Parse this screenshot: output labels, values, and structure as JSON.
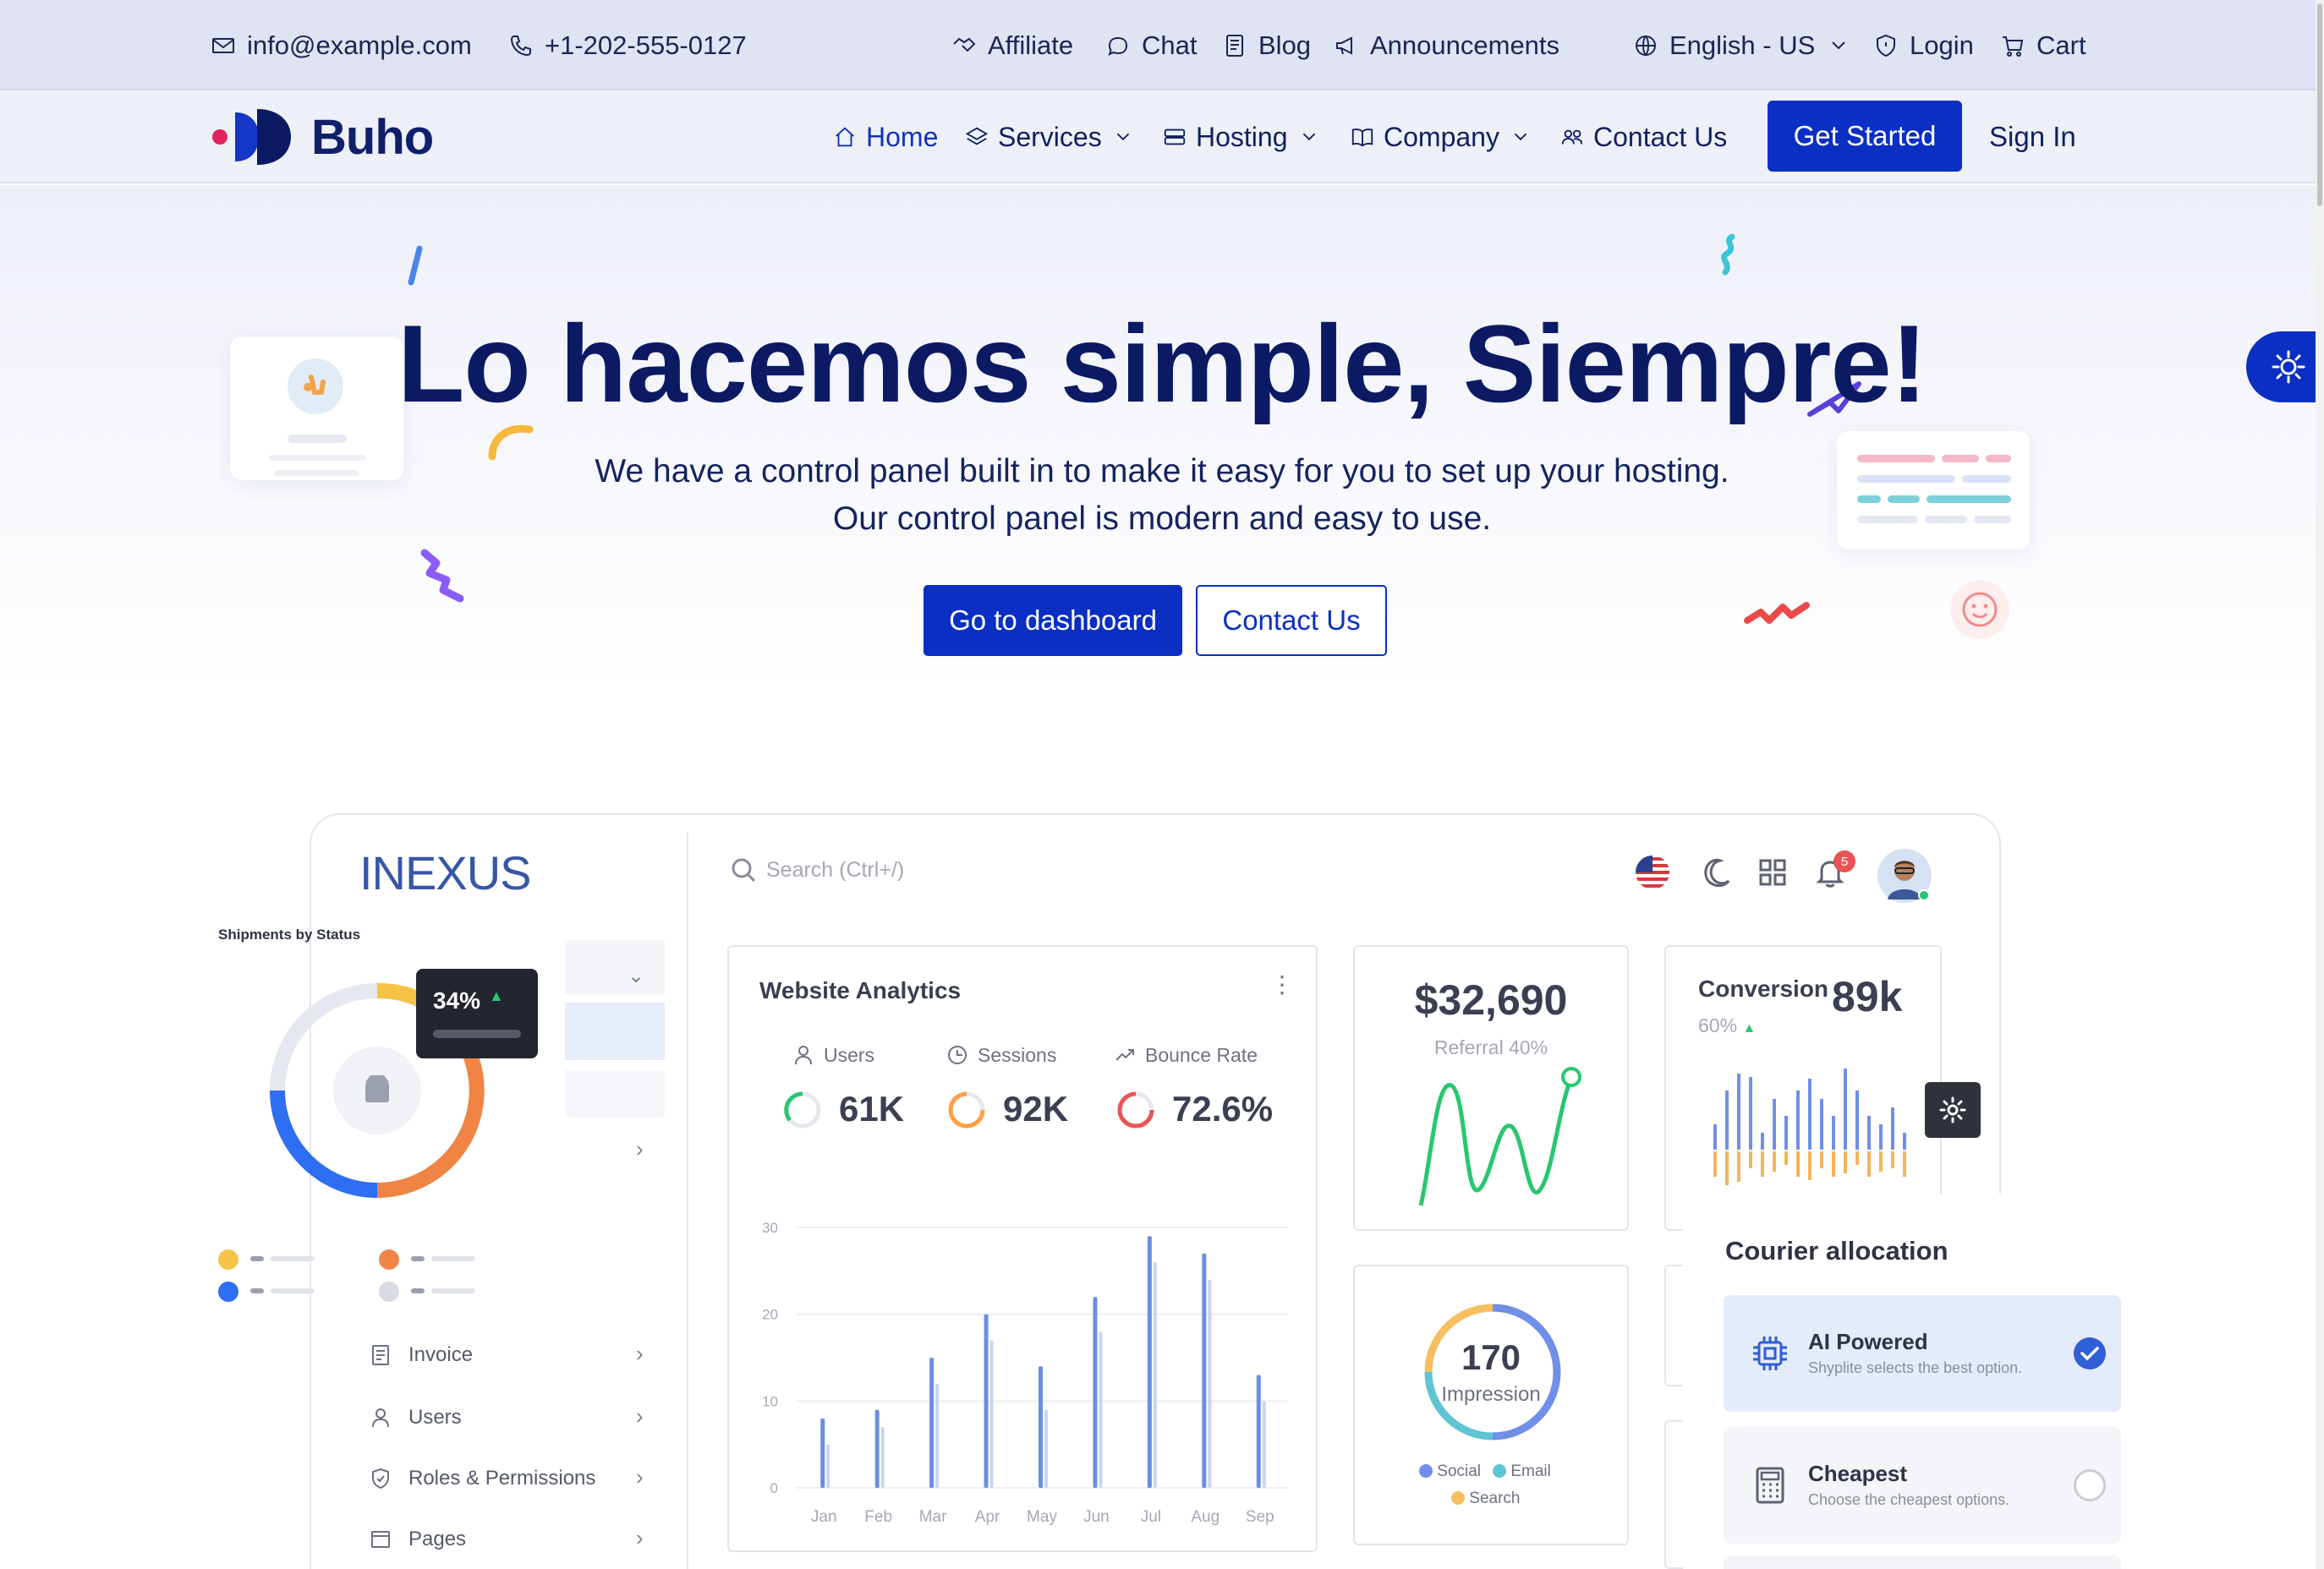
{
  "topbar": {
    "email": "info@example.com",
    "phone": "+1-202-555-0127",
    "affiliate": "Affiliate",
    "chat": "Chat",
    "blog": "Blog",
    "announcements": "Announcements",
    "language": "English - US",
    "login": "Login",
    "cart": "Cart"
  },
  "nav": {
    "brand": "Buho",
    "home": "Home",
    "services": "Services",
    "hosting": "Hosting",
    "company": "Company",
    "contact": "Contact Us",
    "get_started": "Get Started",
    "sign_in": "Sign In"
  },
  "hero": {
    "title": "Lo hacemos simple, Siempre!",
    "subtitle_line1": "We have a control panel built in to make it easy for you to set up your hosting.",
    "subtitle_line2": "Our control panel is modern and easy to use.",
    "btn_dashboard": "Go to dashboard",
    "btn_contact": "Contact Us"
  },
  "dashboard": {
    "brand": "INEXUS",
    "search_placeholder": "Search (Ctrl+/)",
    "notification_count": "5",
    "shipments_title": "Shipments by Status",
    "shipments_percent": "34%",
    "sidebar": [
      "Invoice",
      "Users",
      "Roles & Permissions",
      "Pages"
    ],
    "analytics": {
      "title": "Website Analytics",
      "users_label": "Users",
      "users_value": "61K",
      "sessions_label": "Sessions",
      "sessions_value": "92K",
      "bounce_label": "Bounce Rate",
      "bounce_value": "72.6%"
    },
    "revenue": {
      "value": "$32,690",
      "label": "Referral 40%"
    },
    "conversion": {
      "title": "Conversion",
      "value": "89k",
      "percent": "60%"
    },
    "impression": {
      "value": "170",
      "label": "Impression",
      "legend": [
        "Social",
        "Email",
        "Search"
      ]
    },
    "courier": {
      "title": "Courier allocation",
      "options": [
        {
          "title": "AI Powered",
          "desc": "Shyplite selects the best option."
        },
        {
          "title": "Cheapest",
          "desc": "Choose the cheapest options."
        }
      ]
    }
  },
  "chart_data": {
    "type": "bar",
    "categories": [
      "Jan",
      "Feb",
      "Mar",
      "Apr",
      "May",
      "Jun",
      "Jul",
      "Aug",
      "Sep"
    ],
    "series": [
      {
        "values": [
          8,
          9,
          15,
          20,
          14,
          22,
          29,
          27,
          13
        ]
      },
      {
        "values": [
          5,
          7,
          12,
          17,
          9,
          18,
          26,
          24,
          10
        ]
      }
    ],
    "yticks": [
      "0",
      "10",
      "20",
      "30"
    ],
    "ylim": [
      0,
      30
    ],
    "colors": [
      "#6b8de3",
      "#c8d4f5"
    ]
  },
  "colors": {
    "primary": "#0a2fc2",
    "navy": "#0b1a63"
  }
}
